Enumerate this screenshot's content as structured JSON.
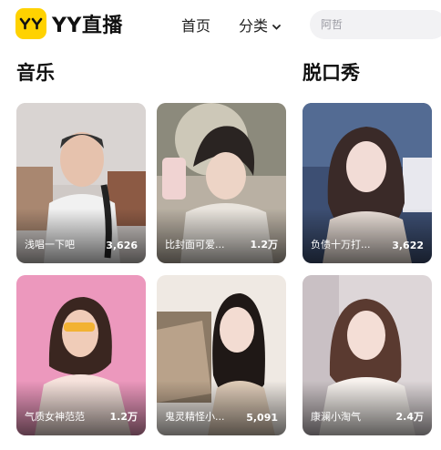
{
  "header": {
    "logo_text": "YY直播",
    "nav": {
      "home": "首页",
      "category": "分类"
    },
    "search": {
      "placeholder": "阿哲"
    }
  },
  "sections": [
    {
      "title": "音乐"
    },
    {
      "title": "脱口秀"
    }
  ],
  "cards": [
    {
      "title": "浅唱一下吧",
      "count": "3,626"
    },
    {
      "title": "比封面可爱...",
      "count": "1.2万"
    },
    {
      "title": "负债十万打...",
      "count": "3,622"
    },
    {
      "title": "气质女神范范",
      "count": "1.2万"
    },
    {
      "title": "鬼灵精怪小...",
      "count": "5,091"
    },
    {
      "title": "康澜小淘气",
      "count": "2.4万"
    }
  ],
  "colors": {
    "brand": "#ffd200",
    "text": "#111111",
    "search_bg": "#f2f2f4"
  }
}
